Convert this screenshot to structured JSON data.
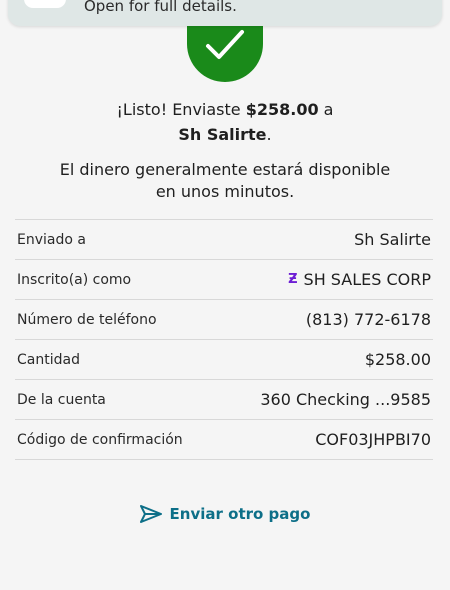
{
  "banner": {
    "text": "Open for full details."
  },
  "confirmation": {
    "prefix": "¡Listo! Enviaste ",
    "amount": "$258.00",
    "connector": " a",
    "recipient": "Sh Salirte",
    "suffix": ".",
    "availability_line1": "El dinero generalmente estará disponible",
    "availability_line2": "en unos minutos."
  },
  "details": {
    "rows": [
      {
        "label": "Enviado a",
        "value": "Sh Salirte"
      },
      {
        "label": "Inscrito(a) como",
        "value": "SH SALES CORP"
      },
      {
        "label": "Número de teléfono",
        "value": "(813) 772-6178"
      },
      {
        "label": "Cantidad",
        "value": "$258.00"
      },
      {
        "label": "De la cuenta",
        "value": "360 Checking ...9585"
      },
      {
        "label": "Código de confirmación",
        "value": "COF03JHPBI70"
      }
    ]
  },
  "actions": {
    "send_another": "Enviar otro pago"
  },
  "icons": {
    "success": "check-icon",
    "enrolled": "zelle-icon",
    "send": "paper-plane-icon"
  },
  "colors": {
    "success_green": "#1a8a1a",
    "link_teal": "#0d6f88",
    "zelle_purple": "#6d1ed4"
  }
}
